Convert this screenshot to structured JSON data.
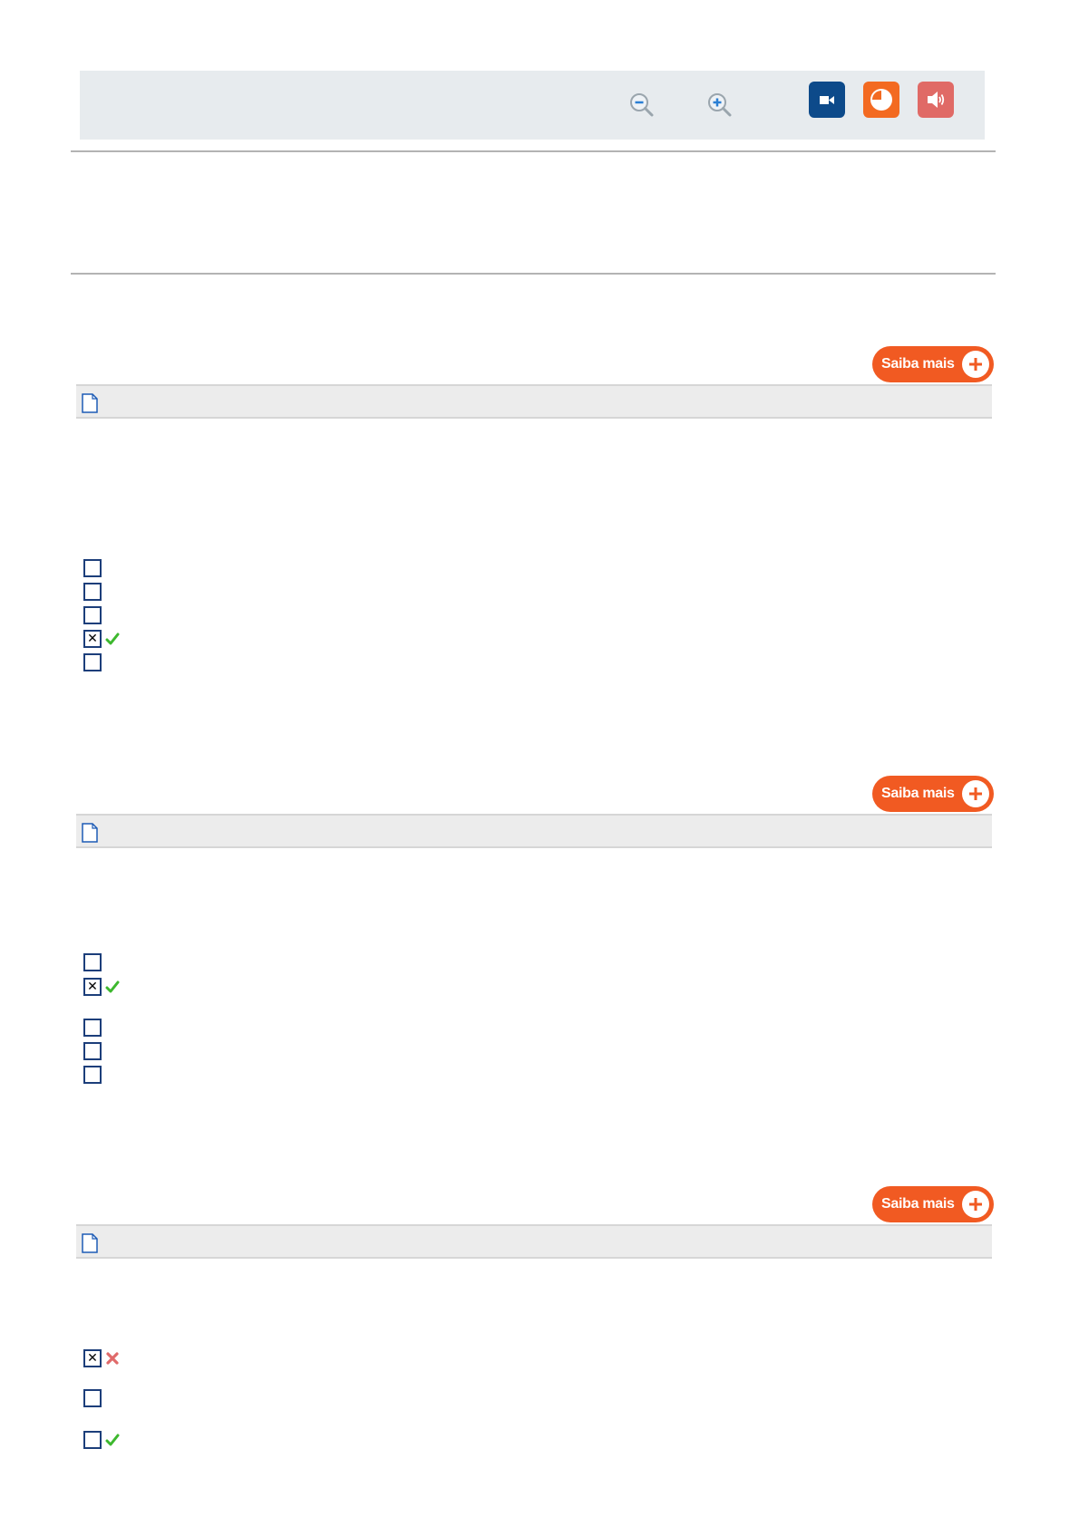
{
  "toolbar": {
    "icons": [
      "zoom-out-icon",
      "zoom-in-icon",
      "video-icon",
      "chart-icon",
      "audio-icon"
    ],
    "colors": {
      "video": "#0d4a8a",
      "chart": "#f36a21",
      "audio": "#e06a66"
    }
  },
  "saiba_label": "Saiba mais",
  "questions": [
    {
      "options": [
        {
          "checked": false,
          "mark": ""
        },
        {
          "checked": false,
          "mark": ""
        },
        {
          "checked": false,
          "mark": ""
        },
        {
          "checked": true,
          "mark": "correct"
        },
        {
          "checked": false,
          "mark": ""
        }
      ]
    },
    {
      "options": [
        {
          "checked": false,
          "mark": ""
        },
        {
          "checked": true,
          "mark": "correct"
        },
        {
          "checked": false,
          "mark": ""
        },
        {
          "checked": false,
          "mark": ""
        },
        {
          "checked": false,
          "mark": ""
        }
      ]
    },
    {
      "options": [
        {
          "checked": true,
          "mark": "wrong"
        },
        {
          "checked": false,
          "mark": ""
        },
        {
          "checked": false,
          "mark": "correct"
        }
      ]
    }
  ],
  "colors": {
    "accent": "#f15a22",
    "checkbox_border": "#1c3e7a",
    "correct": "#3db82e",
    "wrong": "#e06a6a"
  }
}
